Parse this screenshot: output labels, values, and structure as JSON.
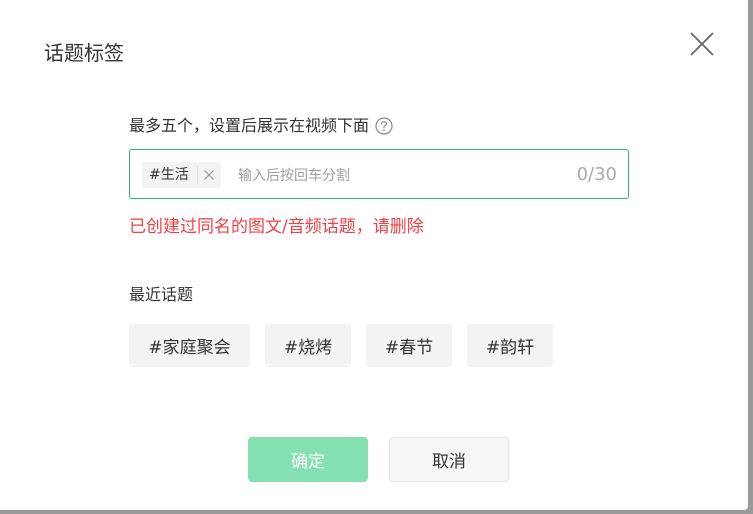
{
  "dialog": {
    "title": "话题标签",
    "close_icon": "close-icon"
  },
  "hint": {
    "text": "最多五个，设置后展示在视频下面",
    "help_icon": "question-circle-icon"
  },
  "tag_input": {
    "chips": [
      {
        "label": "#生活",
        "remove_icon": "close-icon"
      }
    ],
    "placeholder": "输入后按回车分割",
    "value": "",
    "counter": "0/30"
  },
  "error": {
    "text": "已创建过同名的图文/音频话题，请删除",
    "color": "#f04142"
  },
  "recent": {
    "label": "最近话题",
    "tags": [
      "#家庭聚会",
      "#烧烤",
      "#春节",
      "#韵轩"
    ]
  },
  "footer": {
    "confirm_label": "确定",
    "cancel_label": "取消"
  },
  "colors": {
    "accent": "#2db872",
    "confirm_disabled": "#85e0b1"
  }
}
